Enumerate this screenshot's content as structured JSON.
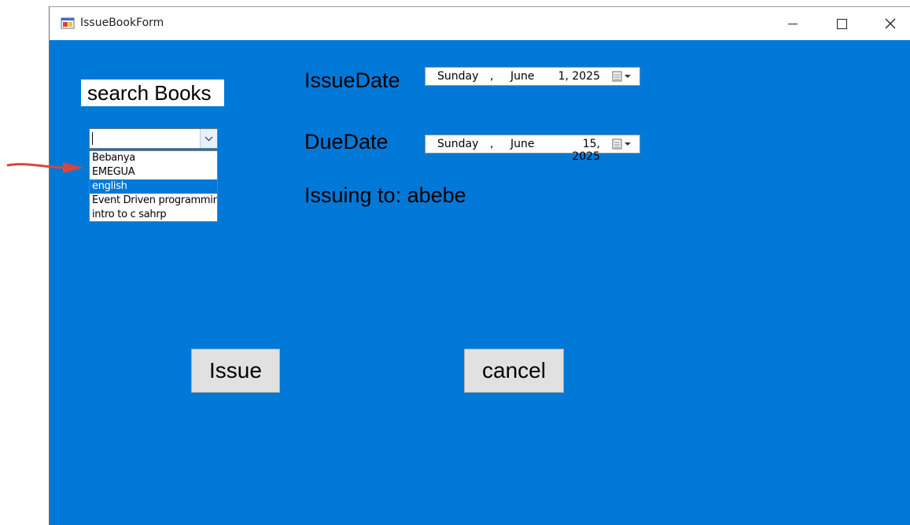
{
  "window": {
    "title": "IssueBookForm"
  },
  "search": {
    "label": "search Books",
    "combo_value": "",
    "options": [
      "Bebanya",
      "EMEGUA",
      "english",
      "Event Driven programming",
      "intro to c sahrp"
    ],
    "selected_index": 2
  },
  "issue_date": {
    "label": "IssueDate",
    "day": "Sunday",
    "sep": ",",
    "month": "June",
    "date": "1, 2025"
  },
  "due_date": {
    "label": "DueDate",
    "day": "Sunday",
    "sep": ",",
    "month": "June",
    "date": "15, 2025"
  },
  "issuing_to": "Issuing to: abebe",
  "buttons": {
    "issue": "Issue",
    "cancel": "cancel"
  },
  "colors": {
    "form_background": "#0078d7",
    "annotation_arrow": "#d9453f"
  },
  "icons": [
    "form-icon",
    "minimize-icon",
    "maximize-icon",
    "close-icon",
    "chevron-down-icon",
    "calendar-icon",
    "annotation-arrow-icon"
  ]
}
